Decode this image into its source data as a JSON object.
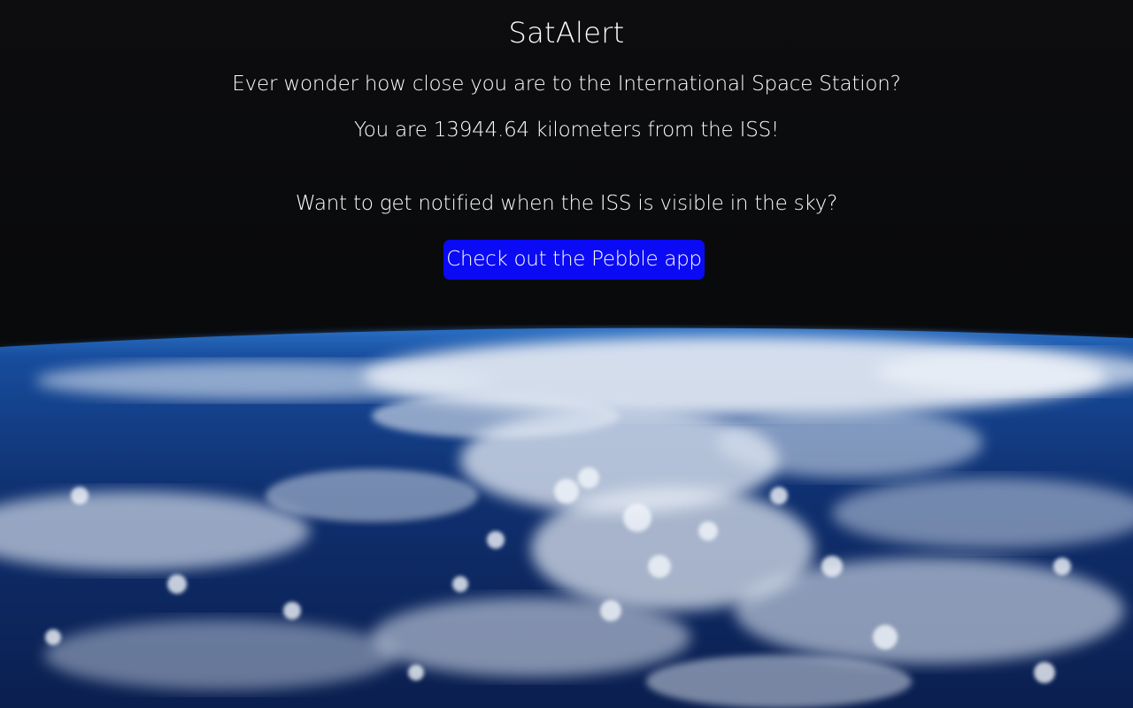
{
  "page": {
    "title": "SatAlert",
    "question": "Ever wonder how close you are to the International Space Station?",
    "distance_text": "You are 13944.64 kilometers from the ISS!",
    "notify_text": "Want to get notified when the ISS is visible in the sky?",
    "pebble_button_label": "Check out the Pebble app"
  },
  "colors": {
    "background": "#0b0b0d",
    "text": "#ffffff",
    "button": "#0a0af5",
    "ocean": "#0e2e6a",
    "clouds": "#e8eef6"
  }
}
